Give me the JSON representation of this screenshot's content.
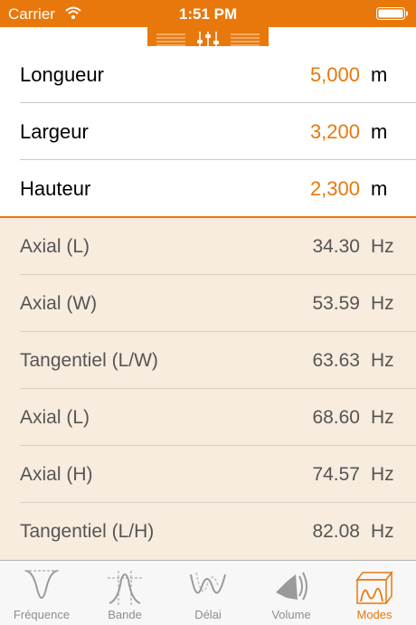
{
  "status_bar": {
    "carrier": "Carrier",
    "time": "1:51 PM"
  },
  "colors": {
    "accent": "#e8780c",
    "results_bg": "#f7ecdd"
  },
  "inputs": [
    {
      "label": "Longueur",
      "value": "5,000",
      "unit": "m"
    },
    {
      "label": "Largeur",
      "value": "3,200",
      "unit": "m"
    },
    {
      "label": "Hauteur",
      "value": "2,300",
      "unit": "m"
    }
  ],
  "results": [
    {
      "label": "Axial (L)",
      "value": "34.30",
      "unit": "Hz"
    },
    {
      "label": "Axial (W)",
      "value": "53.59",
      "unit": "Hz"
    },
    {
      "label": "Tangentiel (L/W)",
      "value": "63.63",
      "unit": "Hz"
    },
    {
      "label": "Axial (L)",
      "value": "68.60",
      "unit": "Hz"
    },
    {
      "label": "Axial (H)",
      "value": "74.57",
      "unit": "Hz"
    },
    {
      "label": "Tangentiel (L/H)",
      "value": "82.08",
      "unit": "Hz"
    }
  ],
  "tabs": [
    {
      "label": "Fréquence",
      "icon": "frequency-curve-icon",
      "active": false
    },
    {
      "label": "Bande",
      "icon": "band-curve-icon",
      "active": false
    },
    {
      "label": "Délai",
      "icon": "delay-wave-icon",
      "active": false
    },
    {
      "label": "Volume",
      "icon": "speaker-volume-icon",
      "active": false
    },
    {
      "label": "Modes",
      "icon": "room-modes-icon",
      "active": true
    }
  ]
}
